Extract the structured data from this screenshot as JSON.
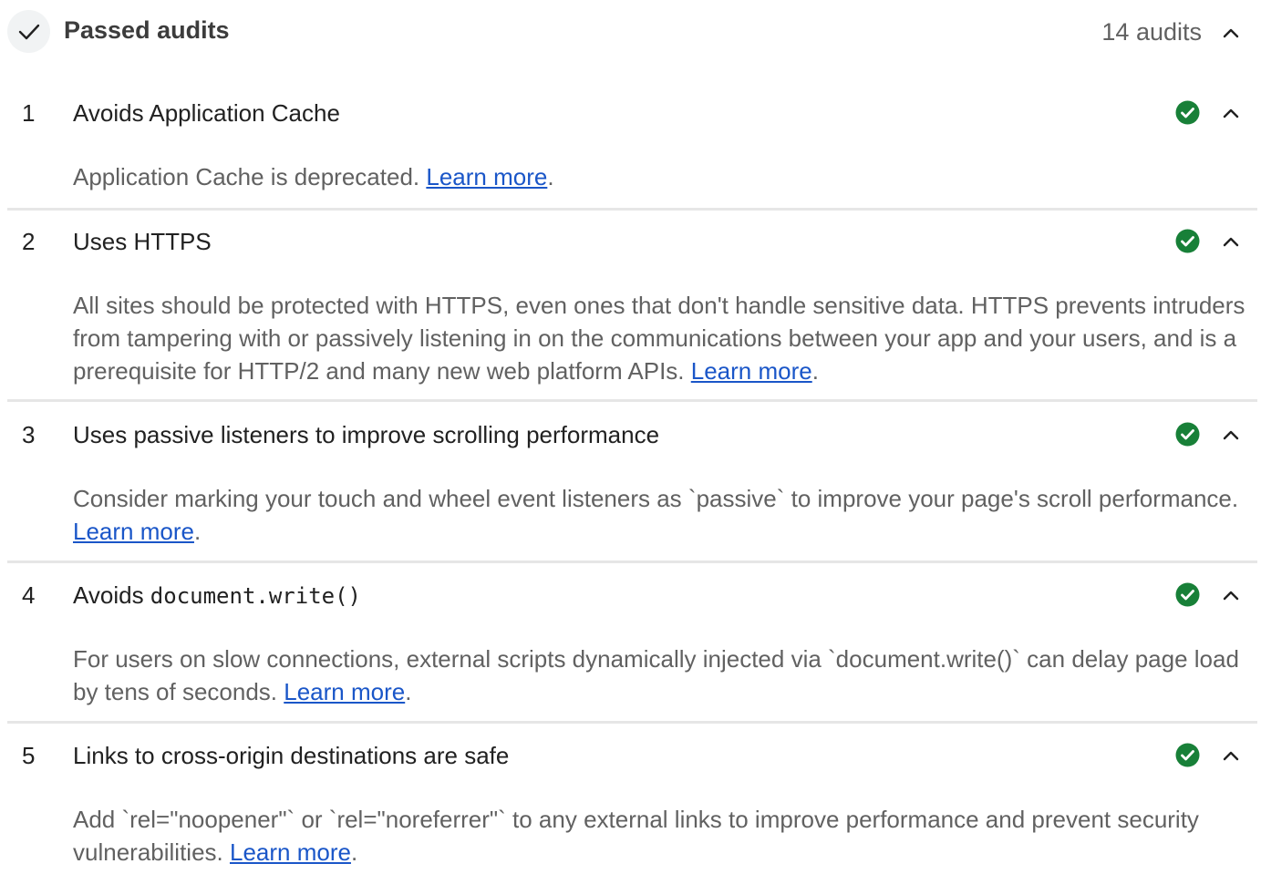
{
  "group": {
    "title": "Passed audits",
    "count_label": "14 audits",
    "icon": "check-icon",
    "expand_icon": "chevron-up-icon"
  },
  "colors": {
    "pass_green": "#188038",
    "link_blue": "#1a56c8"
  },
  "audits": [
    {
      "index": "1",
      "title": "Avoids Application Cache",
      "description": "Application Cache is deprecated. ",
      "link": "Learn more",
      "suffix": ".",
      "status_icon": "pass-check-icon"
    },
    {
      "index": "2",
      "title": "Uses HTTPS",
      "description": "All sites should be protected with HTTPS, even ones that don't handle sensitive data. HTTPS prevents intruders from tampering with or passively listening in on the communications between your app and your users, and is a prerequisite for HTTP/2 and many new web platform APIs. ",
      "link": "Learn more",
      "suffix": ".",
      "status_icon": "pass-check-icon"
    },
    {
      "index": "3",
      "title": "Uses passive listeners to improve scrolling performance",
      "description": "Consider marking your touch and wheel event listeners as `passive` to improve your page's scroll performance. ",
      "link": "Learn more",
      "suffix": ".",
      "status_icon": "pass-check-icon"
    },
    {
      "index": "4",
      "title_prefix": "Avoids ",
      "title_code": "document.write()",
      "description": "For users on slow connections, external scripts dynamically injected via `document.write()` can delay page load by tens of seconds. ",
      "link": "Learn more",
      "suffix": ".",
      "status_icon": "pass-check-icon"
    },
    {
      "index": "5",
      "title": "Links to cross-origin destinations are safe",
      "description": "Add `rel=\"noopener\"` or `rel=\"noreferrer\"` to any external links to improve performance and prevent security vulnerabilities. ",
      "link": "Learn more",
      "suffix": ".",
      "status_icon": "pass-check-icon"
    }
  ]
}
